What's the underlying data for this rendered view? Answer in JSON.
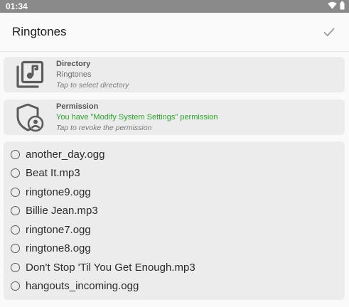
{
  "status_bar": {
    "time": "01:34",
    "icons": [
      "wifi-icon",
      "battery-icon"
    ]
  },
  "app_bar": {
    "title": "Ringtones",
    "action_icon": "check-icon"
  },
  "directory": {
    "title": "Directory",
    "value": "Ringtones",
    "hint": "Tap to select directory",
    "icon": "music-library-icon"
  },
  "permission": {
    "title": "Permission",
    "value": "You have \"Modify System Settings\" permission",
    "hint": "Tap to revoke the permission",
    "icon": "shield-user-icon",
    "value_color": "#2aa52a"
  },
  "ringtones": [
    {
      "label": "another_day.ogg",
      "selected": false
    },
    {
      "label": "Beat It.mp3",
      "selected": false
    },
    {
      "label": "ringtone9.ogg",
      "selected": false
    },
    {
      "label": "Billie Jean.mp3",
      "selected": false
    },
    {
      "label": "ringtone7.ogg",
      "selected": false
    },
    {
      "label": "ringtone8.ogg",
      "selected": false
    },
    {
      "label": "Don't Stop 'Til You Get Enough.mp3",
      "selected": false
    },
    {
      "label": "hangouts_incoming.ogg",
      "selected": false
    }
  ]
}
